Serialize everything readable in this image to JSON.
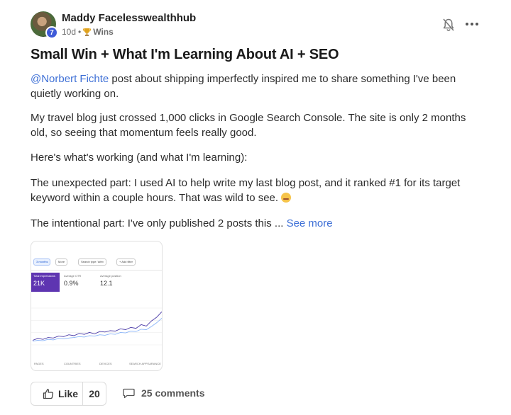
{
  "post": {
    "author": "Maddy Facelesswealthhub",
    "level": "7",
    "age": "10d",
    "separator": "•",
    "category": "Wins",
    "title": "Small Win + What I'm Learning About AI + SEO",
    "mention": "@Norbert Fichte",
    "para1_rest": " post about shipping imperfectly inspired me to share something I've been quietly working on.",
    "para2": "My travel blog just crossed 1,000 clicks in Google Search Console. The site is only 2 months old, so seeing that momentum feels really good.",
    "para3": "Here's what's working (and what I'm learning):",
    "para4": "The unexpected part: I used AI to help write my last blog post, and it ranked #1 for its target keyword within a couple hours. That was wild to see. ",
    "para5": "The intentional part: I've only published 2 posts this ... ",
    "see_more": "See more"
  },
  "attachment": {
    "chips": [
      "3 months",
      "More",
      "Search type: Web",
      "+ Add filter"
    ],
    "metrics": [
      {
        "label": "Total impressions",
        "value": "21K"
      },
      {
        "label": "Average CTR",
        "value": "0.9%"
      },
      {
        "label": "Average position",
        "value": "12.1"
      }
    ],
    "tabs": [
      "PAGES",
      "COUNTRIES",
      "DEVICES",
      "SEARCH APPEARANCE"
    ],
    "chart_data": {
      "type": "line",
      "title": "",
      "series": [
        {
          "values": [
            10,
            14,
            12,
            16,
            15,
            19,
            18,
            22,
            20,
            25,
            23,
            27,
            24,
            29,
            28,
            31,
            30,
            35,
            33,
            38,
            36,
            44,
            41,
            52,
            60,
            72
          ]
        },
        {
          "values": [
            8,
            10,
            9,
            12,
            11,
            14,
            13,
            15,
            16,
            18,
            17,
            20,
            19,
            22,
            21,
            24,
            23,
            27,
            26,
            30,
            29,
            34,
            33,
            40,
            48,
            58
          ]
        }
      ],
      "colors": [
        "#4a3aa7",
        "#8ab4f8"
      ],
      "ylim": [
        0,
        80
      ],
      "grid": true
    }
  },
  "footer": {
    "like_label": "Like",
    "like_count": "20",
    "comments_label": "25 comments"
  }
}
